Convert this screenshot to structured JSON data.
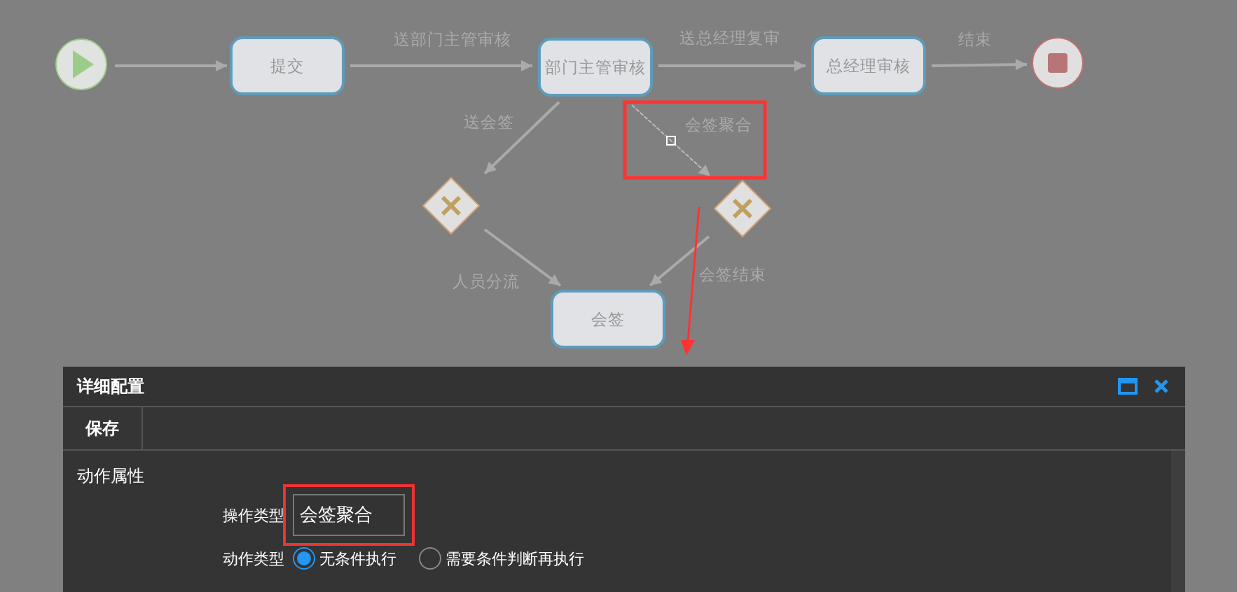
{
  "diagram": {
    "nodes": [
      {
        "kind": "start"
      },
      {
        "kind": "task",
        "label": "提交"
      },
      {
        "kind": "task",
        "label": "部门主管审核"
      },
      {
        "kind": "task",
        "label": "总经理审核"
      },
      {
        "kind": "end"
      },
      {
        "kind": "gateway"
      },
      {
        "kind": "gateway"
      },
      {
        "kind": "task",
        "label": "会签"
      }
    ],
    "edges": [
      {
        "selected": false
      },
      {
        "label": "送部门主管审核",
        "selected": false
      },
      {
        "label": "送总经理复审",
        "selected": false
      },
      {
        "label": "结束",
        "selected": false
      },
      {
        "label": "送会签",
        "selected": false
      },
      {
        "label": "会签聚合",
        "selected": true
      },
      {
        "label": "人员分流",
        "selected": false
      },
      {
        "label": "会签结束",
        "selected": false
      }
    ]
  },
  "panel": {
    "title": "详细配置",
    "toolbar": [
      "保存"
    ],
    "section": "动作属性",
    "operation_type": {
      "label": "操作类型",
      "value": "会签聚合"
    },
    "action_type": {
      "label": "动作类型",
      "options": [
        {
          "label": "无条件执行",
          "selected": true
        },
        {
          "label": "需要条件判断再执行",
          "selected": false
        }
      ]
    }
  }
}
